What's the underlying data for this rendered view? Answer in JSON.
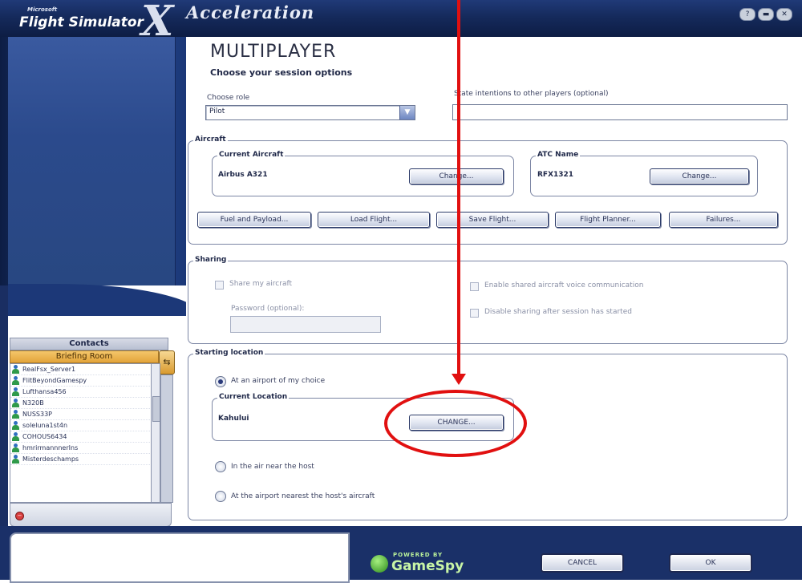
{
  "header": {
    "ms_label": "Microsoft",
    "app_title": "Flight Simulator",
    "edition_mark": "X",
    "expansion_title": "Acceleration",
    "window_controls": [
      "?",
      "▬",
      "✕"
    ]
  },
  "page": {
    "title": "MULTIPLAYER",
    "subtitle": "Choose your session options"
  },
  "session": {
    "role_label": "Choose role",
    "role_value": "Pilot",
    "intent_label": "State intentions to other players (optional)",
    "intent_value": ""
  },
  "aircraft": {
    "group_label": "Aircraft",
    "current_label": "Current Aircraft",
    "current_value": "Airbus A321",
    "change_label": "Change...",
    "atc_label": "ATC Name",
    "atc_value": "RFX1321",
    "atc_change_label": "Change...",
    "buttons": [
      "Fuel and Payload...",
      "Load Flight...",
      "Save Flight...",
      "Flight Planner...",
      "Failures..."
    ]
  },
  "sharing": {
    "group_label": "Sharing",
    "share_label": "Share my aircraft",
    "password_label": "Password (optional):",
    "voice_label": "Enable shared aircraft voice communication",
    "disable_label": "Disable sharing after session has started"
  },
  "starting_location": {
    "group_label": "Starting location",
    "option_airport": "At an airport of my choice",
    "current_location_label": "Current Location",
    "current_location_value": "Kahului",
    "change_label": "CHANGE...",
    "option_air": "In the air near the host",
    "option_nearest": "At the airport nearest the host's aircraft"
  },
  "contacts": {
    "title": "Contacts",
    "room": "Briefing Room",
    "items": [
      "RealFsx_Server1",
      "FlitBeyondGamespy",
      "Lufthansa456",
      "N320B",
      "NUSS33P",
      "soleluna1st4n",
      "COHOUS6434",
      "hmrirmannnerIns",
      "Misterdeschamps"
    ]
  },
  "footer": {
    "powered_by": "POWERED BY",
    "gamespy": "GameSpy",
    "cancel_label": "CANCEL",
    "ok_label": "OK"
  }
}
